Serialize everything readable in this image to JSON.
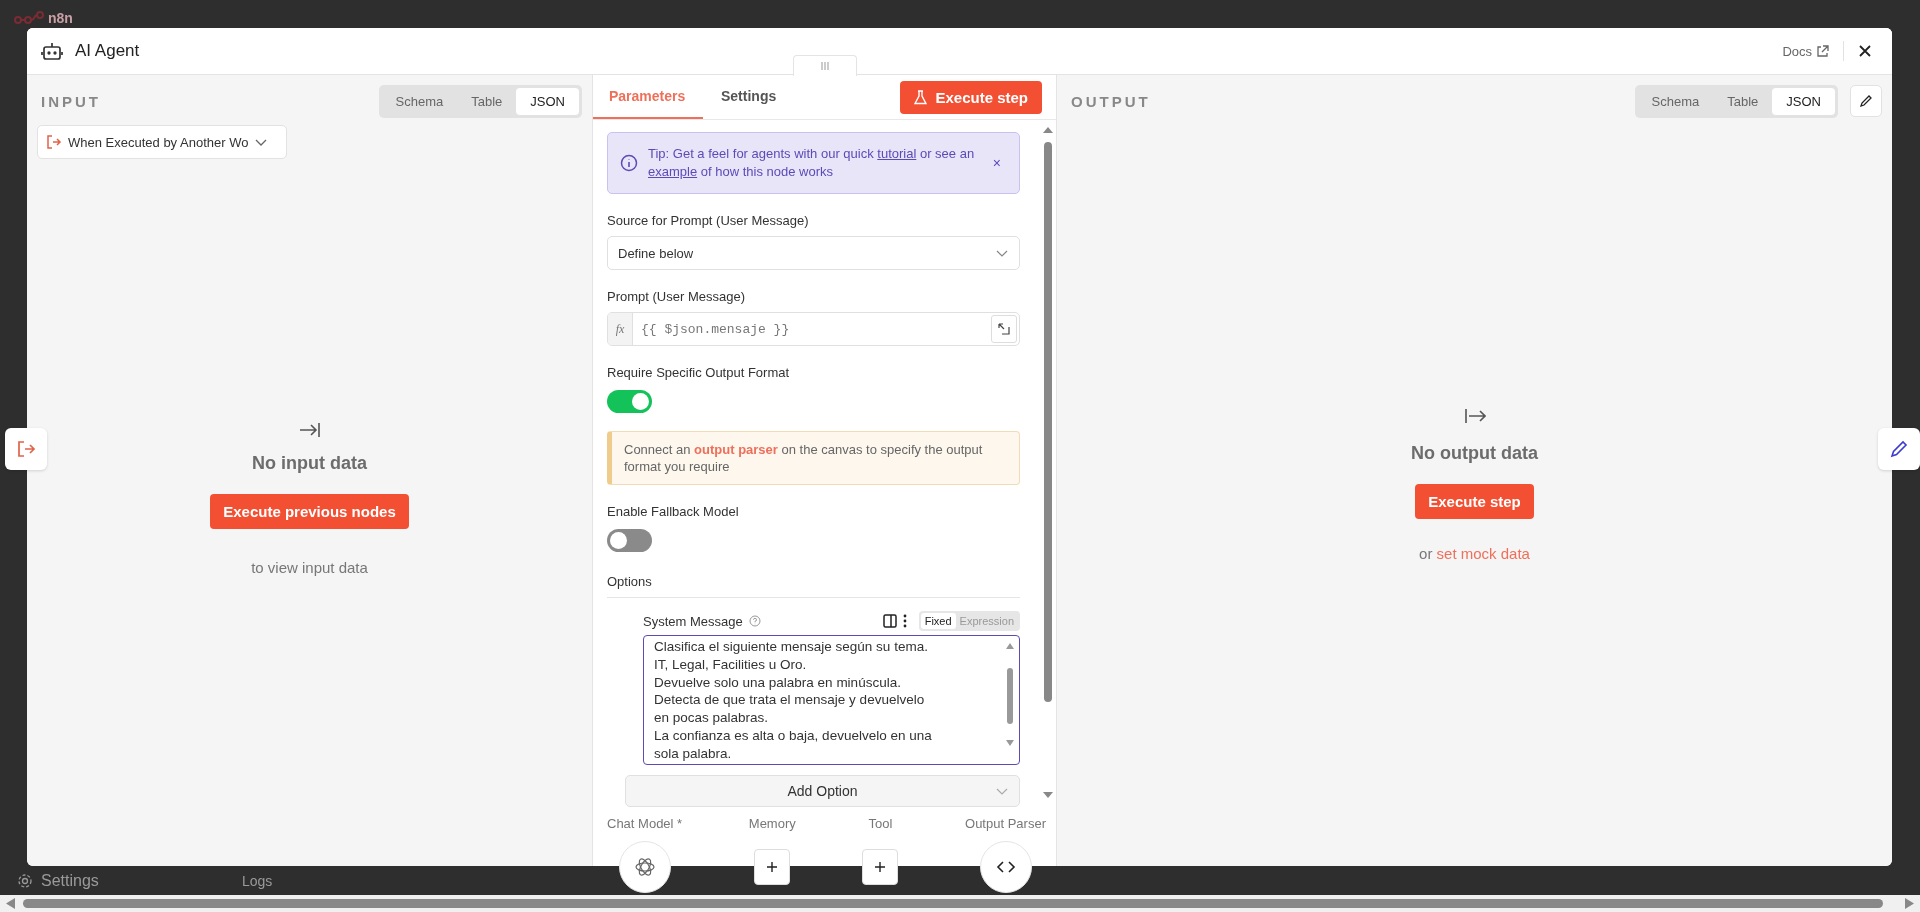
{
  "app": {
    "logo": "n8n",
    "sidebar_bottom": "Settings",
    "logs": "Logs"
  },
  "window": {
    "title": "AI Agent",
    "docs": "Docs"
  },
  "input": {
    "label": "INPUT",
    "tabs": [
      {
        "label": "Schema",
        "selected": false
      },
      {
        "label": "Table",
        "selected": false
      },
      {
        "label": "JSON",
        "selected": true
      }
    ],
    "source": "When Executed by Another Wo",
    "empty_title": "No input data",
    "button": "Execute previous nodes",
    "hint": "to view input data"
  },
  "parameters": {
    "tabs": [
      {
        "label": "Parameters",
        "selected": true
      },
      {
        "label": "Settings",
        "selected": false
      }
    ],
    "execute": "Execute step",
    "tip": "Tip: Get a feel for agents with our quick **tutorial** or see an **example** of how this node works",
    "tip_close": "×",
    "fields": [
      {
        "kind": "select",
        "label": "Source for Prompt (User Message)",
        "value": "Define below"
      },
      {
        "kind": "expression",
        "label": "Prompt (User Message)",
        "fx": "fx",
        "value": "{{ $json.mensaje }}"
      },
      {
        "kind": "toggle",
        "label": "Require Specific Output Format",
        "on": true
      },
      {
        "kind": "notice",
        "text": "Connect an **output parser** on the canvas to specify the output format you require"
      },
      {
        "kind": "toggle",
        "label": "Enable Fallback Model",
        "on": false
      }
    ],
    "options_label": "Options",
    "system_message": {
      "label": "System Message",
      "modes": [
        {
          "label": "Fixed",
          "selected": true
        },
        {
          "label": "Expression",
          "selected": false
        }
      ],
      "lines": [
        "Clasifica el siguiente mensaje según su tema.",
        "IT, Legal, Facilities u Oro.",
        "Devuelve solo una palabra en minúscula.",
        "Detecta de que trata el mensaje y devuelvelo",
        "en pocas palabras.",
        "La confianza es alta o baja, devuelvelo en una",
        "sola palabra."
      ]
    },
    "add_option": "Add Option",
    "connectors": [
      {
        "label": "Chat Model *",
        "kind": "model"
      },
      {
        "label": "Memory",
        "kind": "add"
      },
      {
        "label": "Tool",
        "kind": "add"
      },
      {
        "label": "Output Parser",
        "kind": "parser"
      }
    ]
  },
  "output": {
    "label": "OUTPUT",
    "tabs": [
      {
        "label": "Schema",
        "selected": false
      },
      {
        "label": "Table",
        "selected": false
      },
      {
        "label": "JSON",
        "selected": true
      }
    ],
    "empty_title": "No output data",
    "button": "Execute step",
    "or": "or",
    "link": "set mock data"
  }
}
